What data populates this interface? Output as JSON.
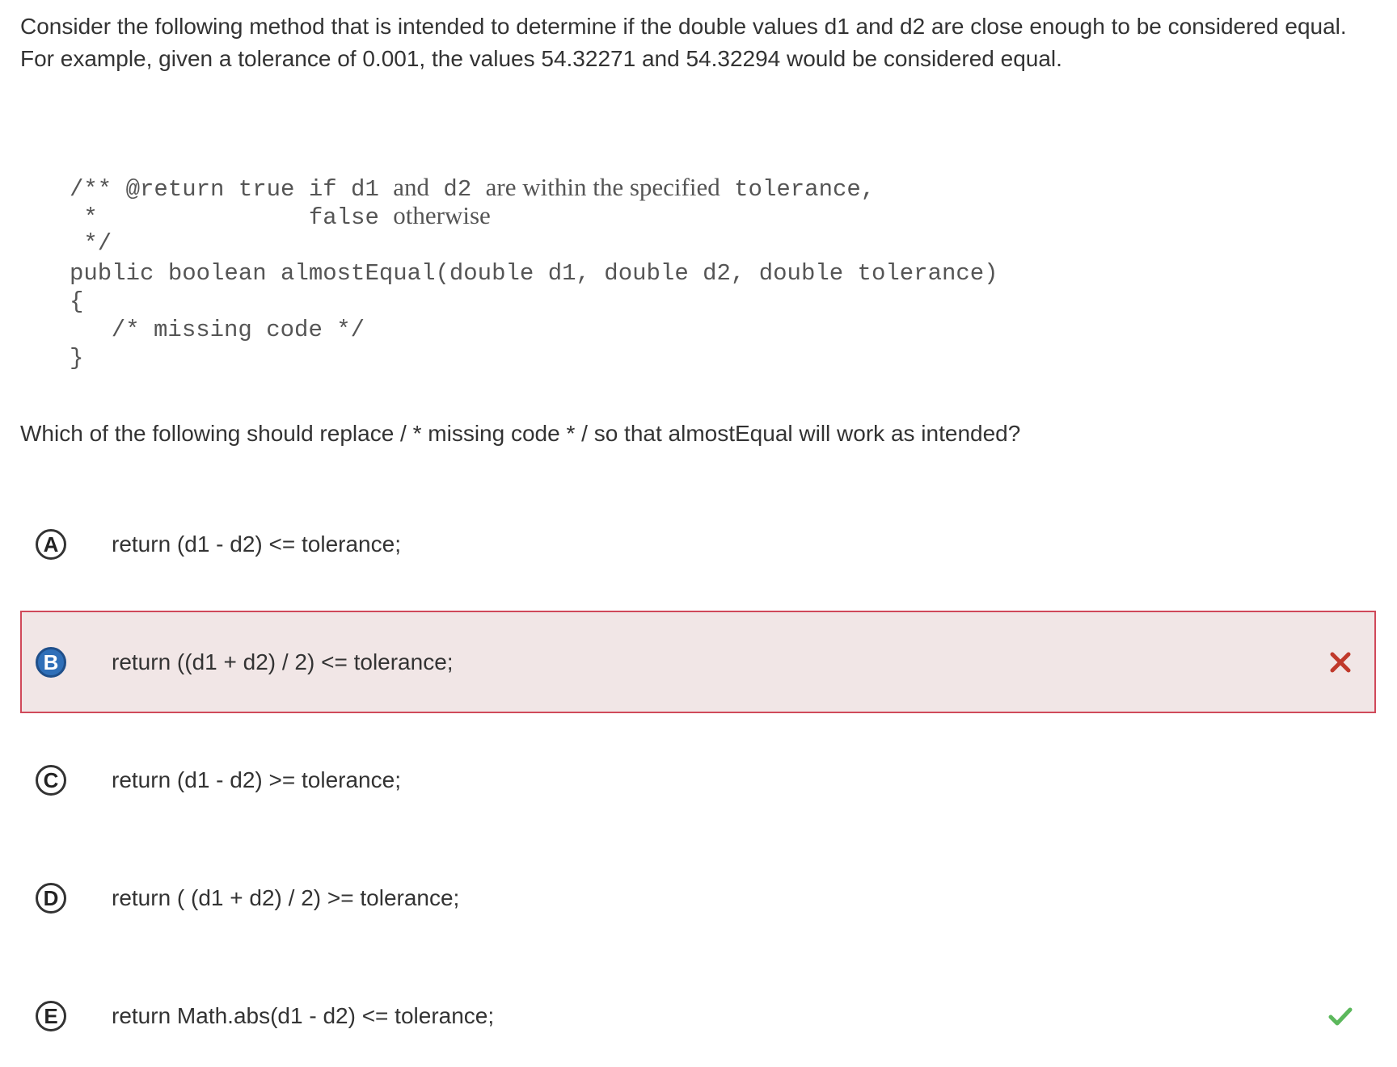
{
  "stem": {
    "line1": "Consider the following method that is intended to determine if the double values d1 and d2 are close enough to be considered equal.",
    "line2": "For example, given a tolerance of 0.001, the values 54.32271 and 54.32294 would be considered equal."
  },
  "code": {
    "l1_mono_a": "/** @return true if d1 ",
    "l1_serif_a": "and",
    "l1_mono_b": " d2 ",
    "l1_serif_b": "are within the specified",
    "l1_mono_c": " tolerance,",
    "l2_mono": " *               false ",
    "l2_serif": "otherwise",
    "l3": " */",
    "l4": "public boolean almostEqual(double d1, double d2, double tolerance)",
    "l5": "{",
    "l6": "  /* missing code */",
    "l7": "}"
  },
  "question": "Which of the following should replace / * missing code * / so that almostEqual will work as intended?",
  "choices": [
    {
      "letter": "A",
      "text": "return (d1 - d2) <= tolerance;"
    },
    {
      "letter": "B",
      "text": "return ((d1 + d2) / 2) <= tolerance;",
      "state": "selected-incorrect"
    },
    {
      "letter": "C",
      "text": "return (d1 - d2) >= tolerance;"
    },
    {
      "letter": "D",
      "text": "return ( (d1 + d2) / 2) >= tolerance;"
    },
    {
      "letter": "E",
      "text": "return Math.abs(d1 - d2) <= tolerance;",
      "state": "correct"
    }
  ],
  "icons": {
    "incorrect": "x-mark-icon",
    "correct": "check-mark-icon"
  },
  "colors": {
    "incorrect_border": "#d0495a",
    "incorrect_background": "#f1e6e6",
    "incorrect_mark": "#c0392b",
    "correct_mark": "#5cb85c",
    "selected_letter_bg": "#2f6fb8"
  }
}
